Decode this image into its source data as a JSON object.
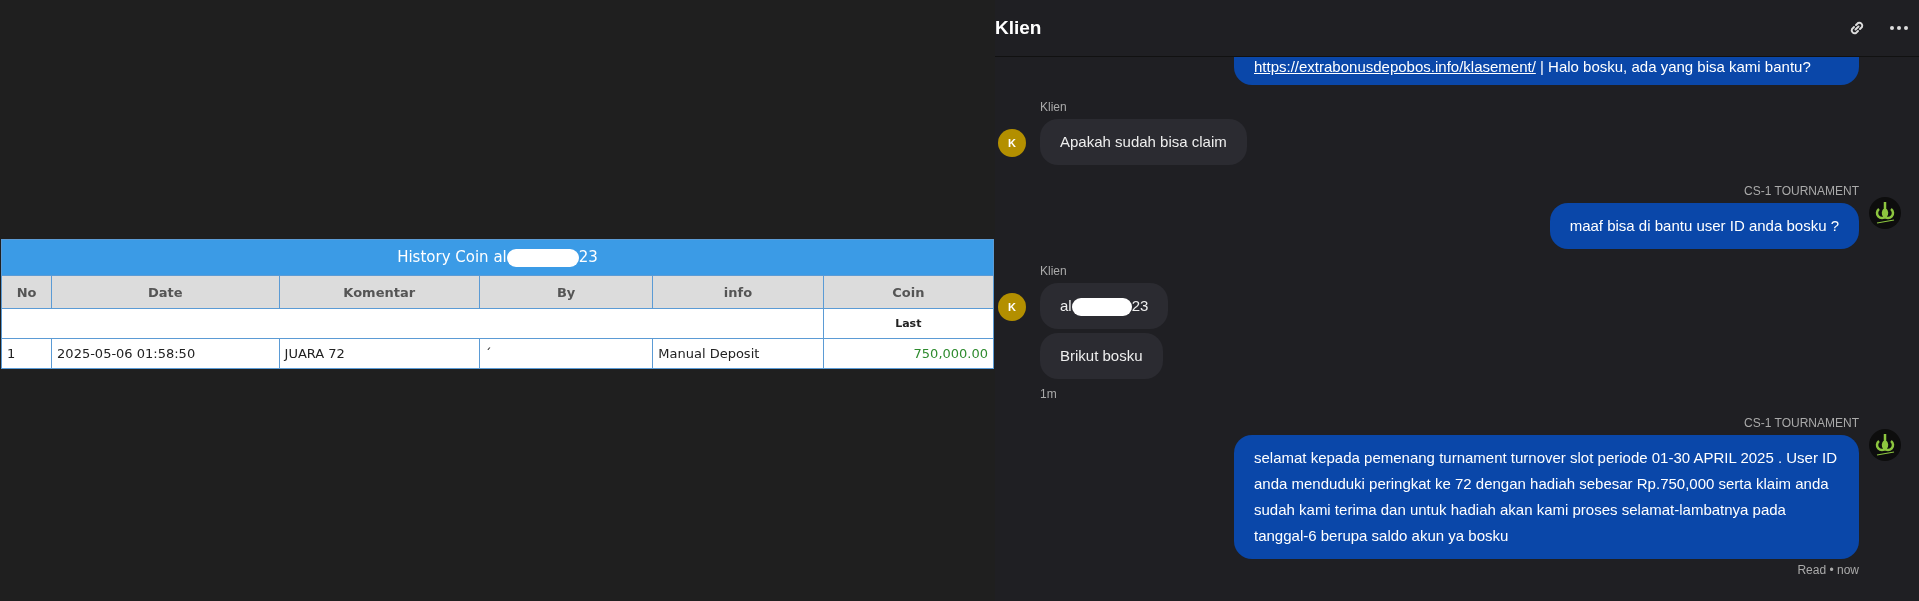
{
  "history_table": {
    "title_prefix": "History Coin al",
    "title_redacted": true,
    "title_suffix": "23",
    "columns": [
      "No",
      "Date",
      "Komentar",
      "By",
      "info",
      "Coin"
    ],
    "subheader": "Last",
    "rows": [
      {
        "no": "1",
        "date": "2025-05-06 01:58:50",
        "komentar": "JUARA 72",
        "by": "ˊ",
        "info": "Manual Deposit",
        "coin": "750,000.00"
      }
    ]
  },
  "chat": {
    "title": "Klien",
    "messages": [
      {
        "kind": "outgoing",
        "link": "https://extrabonusdepobos.info/klasement/",
        "text": " | Halo bosku, ada yang bisa kami bantu?"
      },
      {
        "kind": "incoming",
        "sender": "Klien",
        "avatar": "K",
        "bubbles": [
          {
            "text": "Apakah sudah bisa claim"
          }
        ]
      },
      {
        "kind": "outgoing",
        "sender": "CS-1 TOURNAMENT",
        "text": "maaf bisa di bantu user ID anda bosku ?"
      },
      {
        "kind": "incoming",
        "sender": "Klien",
        "avatar": "K",
        "bubbles": [
          {
            "prefix": "al",
            "redacted": true,
            "suffix": "23"
          },
          {
            "text": "Brikut bosku"
          }
        ],
        "time": "1m"
      },
      {
        "kind": "outgoing",
        "sender": "CS-1 TOURNAMENT",
        "text": "selamat kepada pemenang turnament turnover slot periode 01-30 APRIL 2025 . User ID anda menduduki peringkat ke 72 dengan hadiah sebesar Rp.750,000 serta klaim anda sudah kami terima dan untuk hadiah akan kami proses selamat-lambatnya pada tanggal-6 berupa saldo akun ya bosku",
        "status": "Read",
        "separator": "•",
        "time": "now"
      }
    ]
  }
}
